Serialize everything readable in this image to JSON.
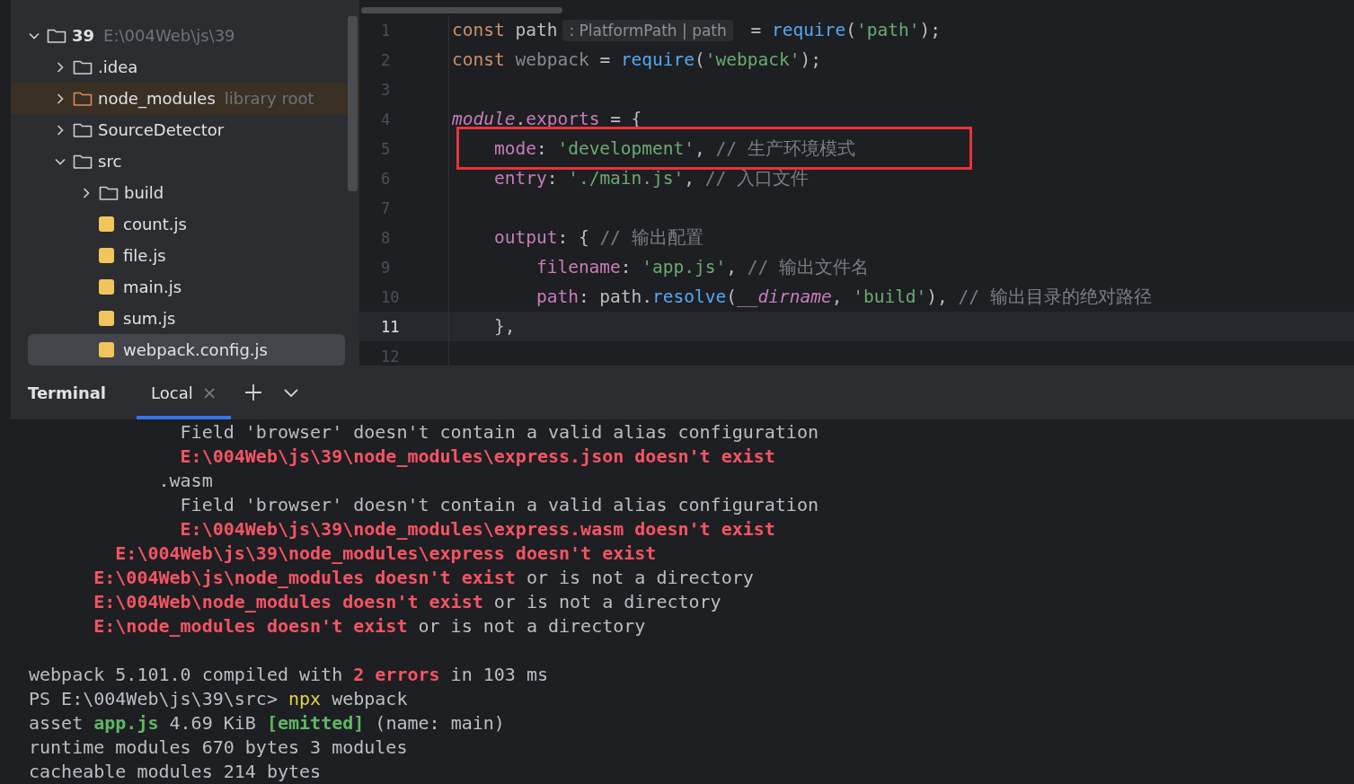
{
  "project_tree": [
    {
      "name": "39",
      "kind": "folder",
      "bold": true,
      "expanded": true,
      "note": "E:\\004Web\\js\\39",
      "selected": false,
      "children": [
        {
          "name": ".idea",
          "kind": "folder",
          "expanded": false,
          "selected": false
        },
        {
          "name": "node_modules",
          "kind": "library",
          "expanded": false,
          "note": "library root",
          "selected": false
        },
        {
          "name": "SourceDetector",
          "kind": "folder",
          "expanded": false,
          "selected": false
        },
        {
          "name": "src",
          "kind": "folder",
          "expanded": true,
          "selected": false,
          "children": [
            {
              "name": "build",
              "kind": "folder",
              "expanded": false,
              "selected": false
            },
            {
              "name": "count.js",
              "kind": "js",
              "selected": false
            },
            {
              "name": "file.js",
              "kind": "js",
              "selected": false
            },
            {
              "name": "main.js",
              "kind": "js",
              "selected": false
            },
            {
              "name": "sum.js",
              "kind": "js",
              "selected": false
            },
            {
              "name": "webpack.config.js",
              "kind": "js",
              "selected": true
            }
          ]
        }
      ]
    }
  ],
  "editor": {
    "lines": [
      {
        "number": "1",
        "current": false,
        "boxed": false,
        "tokens": [
          {
            "text": "const ",
            "kind": "keyword"
          },
          {
            "text": "path",
            "kind": "plain"
          },
          {
            "text": ": PlatformPath | path",
            "kind": "hint"
          },
          {
            "text": " = ",
            "kind": "plain"
          },
          {
            "text": "require",
            "kind": "function"
          },
          {
            "text": "(",
            "kind": "plain"
          },
          {
            "text": "'path'",
            "kind": "string"
          },
          {
            "text": ");",
            "kind": "plain"
          }
        ]
      },
      {
        "number": "2",
        "current": false,
        "boxed": false,
        "tokens": [
          {
            "text": "const ",
            "kind": "keyword"
          },
          {
            "text": "webpack",
            "kind": "unused"
          },
          {
            "text": " = ",
            "kind": "plain"
          },
          {
            "text": "require",
            "kind": "function"
          },
          {
            "text": "(",
            "kind": "plain"
          },
          {
            "text": "'webpack'",
            "kind": "string"
          },
          {
            "text": ");",
            "kind": "plain"
          }
        ]
      },
      {
        "number": "3",
        "current": false,
        "boxed": false
      },
      {
        "number": "4",
        "current": false,
        "boxed": false,
        "tokens": [
          {
            "text": "module",
            "kind": "global"
          },
          {
            "text": ".",
            "kind": "plain"
          },
          {
            "text": "exports",
            "kind": "property"
          },
          {
            "text": " = {",
            "kind": "plain"
          }
        ]
      },
      {
        "number": "5",
        "current": false,
        "boxed": true,
        "tokens": [
          {
            "text": "    mode",
            "kind": "property"
          },
          {
            "text": ": ",
            "kind": "plain"
          },
          {
            "text": "'development'",
            "kind": "string"
          },
          {
            "text": ", ",
            "kind": "plain"
          },
          {
            "text": "// 生产环境模式",
            "kind": "comment"
          }
        ]
      },
      {
        "number": "6",
        "current": false,
        "boxed": false,
        "tokens": [
          {
            "text": "    entry",
            "kind": "property"
          },
          {
            "text": ": ",
            "kind": "plain"
          },
          {
            "text": "'./main.js'",
            "kind": "string"
          },
          {
            "text": ", ",
            "kind": "plain"
          },
          {
            "text": "// 入口文件",
            "kind": "comment"
          }
        ]
      },
      {
        "number": "7",
        "current": false,
        "boxed": false
      },
      {
        "number": "8",
        "current": false,
        "boxed": false,
        "tokens": [
          {
            "text": "    output",
            "kind": "property"
          },
          {
            "text": ": { ",
            "kind": "plain"
          },
          {
            "text": "// 输出配置",
            "kind": "comment"
          }
        ]
      },
      {
        "number": "9",
        "current": false,
        "boxed": false,
        "tokens": [
          {
            "text": "        filename",
            "kind": "property"
          },
          {
            "text": ": ",
            "kind": "plain"
          },
          {
            "text": "'app.js'",
            "kind": "string"
          },
          {
            "text": ", ",
            "kind": "plain"
          },
          {
            "text": "// 输出文件名",
            "kind": "comment"
          }
        ]
      },
      {
        "number": "10",
        "current": false,
        "boxed": false,
        "tokens": [
          {
            "text": "        path",
            "kind": "property"
          },
          {
            "text": ": path.",
            "kind": "plain"
          },
          {
            "text": "resolve",
            "kind": "function"
          },
          {
            "text": "(",
            "kind": "plain"
          },
          {
            "text": "__dirname",
            "kind": "global"
          },
          {
            "text": ", ",
            "kind": "plain"
          },
          {
            "text": "'build'",
            "kind": "string"
          },
          {
            "text": "), ",
            "kind": "plain"
          },
          {
            "text": "// 输出目录的绝对路径",
            "kind": "comment"
          }
        ]
      },
      {
        "number": "11",
        "current": true,
        "boxed": false,
        "tokens": [
          {
            "text": "    },",
            "kind": "plain"
          }
        ]
      },
      {
        "number": "12",
        "current": false,
        "boxed": false
      }
    ]
  },
  "terminal": {
    "title": "Terminal",
    "tabs": [
      {
        "label": "Local",
        "selected": true,
        "close": "×"
      }
    ],
    "lines": [
      {
        "kind": "text",
        "segments": [
          {
            "text": "              Field 'browser' doesn't contain a valid alias configuration",
            "kind": "plain"
          }
        ]
      },
      {
        "kind": "text",
        "segments": [
          {
            "text": "              E:\\004Web\\js\\39\\node_modules\\express.json doesn't exist",
            "kind": "error"
          }
        ]
      },
      {
        "kind": "text",
        "segments": [
          {
            "text": "            .wasm",
            "kind": "plain"
          }
        ]
      },
      {
        "kind": "text",
        "segments": [
          {
            "text": "              Field 'browser' doesn't contain a valid alias configuration",
            "kind": "plain"
          }
        ]
      },
      {
        "kind": "text",
        "segments": [
          {
            "text": "              E:\\004Web\\js\\39\\node_modules\\express.wasm doesn't exist",
            "kind": "error"
          }
        ]
      },
      {
        "kind": "text",
        "segments": [
          {
            "text": "        E:\\004Web\\js\\39\\node_modules\\express doesn't exist",
            "kind": "error"
          }
        ]
      },
      {
        "kind": "text",
        "segments": [
          {
            "text": "      E:\\004Web\\js\\node_modules doesn't exist",
            "kind": "error"
          },
          {
            "text": " or is not a directory",
            "kind": "plain"
          }
        ]
      },
      {
        "kind": "text",
        "segments": [
          {
            "text": "      E:\\004Web\\node_modules doesn't exist",
            "kind": "error"
          },
          {
            "text": " or is not a directory",
            "kind": "plain"
          }
        ]
      },
      {
        "kind": "text",
        "segments": [
          {
            "text": "      E:\\node_modules doesn't exist",
            "kind": "error"
          },
          {
            "text": " or is not a directory",
            "kind": "plain"
          }
        ]
      },
      {
        "kind": "blank"
      },
      {
        "kind": "text",
        "segments": [
          {
            "text": "webpack 5.101.0 compiled with ",
            "kind": "plain"
          },
          {
            "text": "2 errors",
            "kind": "error"
          },
          {
            "text": " in 103 ms",
            "kind": "plain"
          }
        ]
      },
      {
        "kind": "text",
        "segments": [
          {
            "text": "PS E:\\004Web\\js\\39\\src> ",
            "kind": "plain"
          },
          {
            "text": "npx",
            "kind": "command"
          },
          {
            "text": " webpack",
            "kind": "plain"
          }
        ]
      },
      {
        "kind": "text",
        "segments": [
          {
            "text": "asset ",
            "kind": "plain"
          },
          {
            "text": "app.js",
            "kind": "success"
          },
          {
            "text": " 4.69 KiB ",
            "kind": "plain"
          },
          {
            "text": "[emitted]",
            "kind": "success"
          },
          {
            "text": " (name: main)",
            "kind": "plain"
          }
        ]
      },
      {
        "kind": "text",
        "segments": [
          {
            "text": "runtime modules 670 bytes 3 modules",
            "kind": "plain"
          }
        ]
      },
      {
        "kind": "text",
        "segments": [
          {
            "text": "cacheable modules 214 bytes",
            "kind": "plain"
          }
        ]
      }
    ]
  }
}
